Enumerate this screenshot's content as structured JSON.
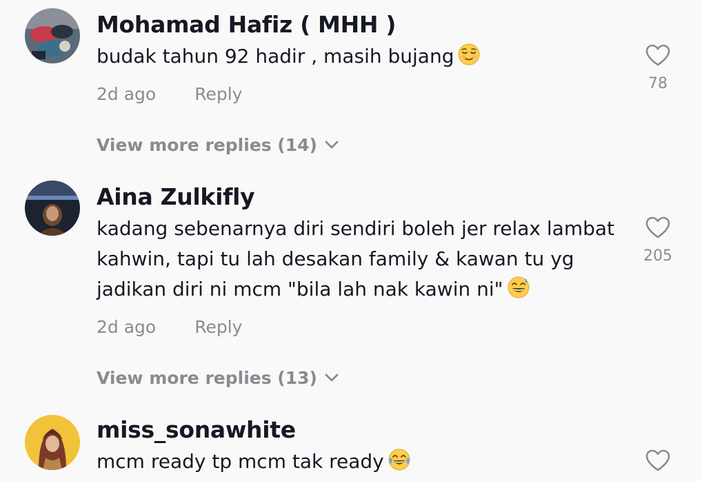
{
  "comments": [
    {
      "author": "Mohamad Hafiz ( MHH )",
      "lines": [
        "budak tahun 92 hadir , masih bujang"
      ],
      "emoji": "relieved-face",
      "time": "2d ago",
      "reply_label": "Reply",
      "likes": "78",
      "more_replies": "View more replies (14)"
    },
    {
      "author": "Aina Zulkifly",
      "lines": [
        "kadang sebenarnya diri sendiri boleh jer relax lambat",
        "kahwin, tapi tu lah desakan family & kawan tu yg",
        "jadikan diri ni mcm \"bila lah nak kawin ni\""
      ],
      "emoji": "grinning-sweat-face",
      "time": "2d ago",
      "reply_label": "Reply",
      "likes": "205",
      "more_replies": "View more replies (13)"
    },
    {
      "author": "miss_sonawhite",
      "lines": [
        "mcm ready tp mcm tak ready"
      ],
      "emoji": "tears-of-joy-face"
    }
  ]
}
